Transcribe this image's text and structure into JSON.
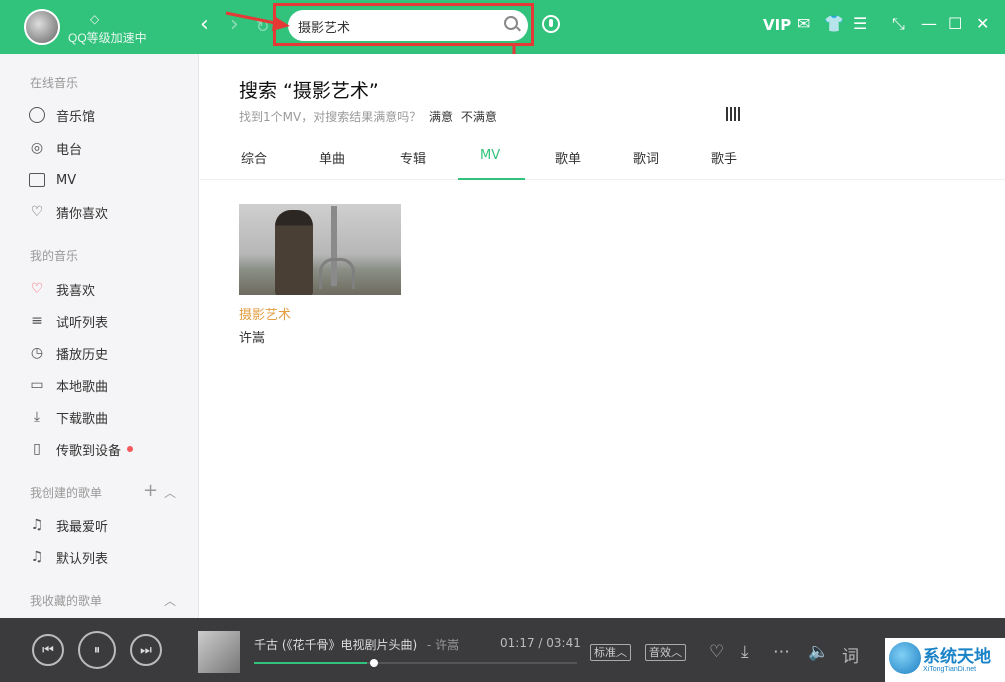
{
  "app": {
    "user": {
      "name": "QQ等级加速中"
    }
  },
  "search": {
    "value": "摄影艺术"
  },
  "topbar": {
    "vip_label": "VIP"
  },
  "sidebar": {
    "online_title": "在线音乐",
    "online": [
      {
        "label": "音乐馆",
        "icon": "music-hall-icon"
      },
      {
        "label": "电台",
        "icon": "radio-icon"
      },
      {
        "label": "MV",
        "icon": "mv-icon"
      },
      {
        "label": "猜你喜欢",
        "icon": "heart-guess-icon"
      }
    ],
    "my_title": "我的音乐",
    "my": [
      {
        "label": "我喜欢",
        "icon": "heart-icon"
      },
      {
        "label": "试听列表",
        "icon": "playlist-icon"
      },
      {
        "label": "播放历史",
        "icon": "history-icon"
      },
      {
        "label": "本地歌曲",
        "icon": "computer-icon"
      },
      {
        "label": "下载歌曲",
        "icon": "download-icon"
      },
      {
        "label": "传歌到设备",
        "icon": "device-icon"
      }
    ],
    "created_title": "我创建的歌单",
    "created": [
      {
        "label": "我最爱听",
        "icon": "note-icon"
      },
      {
        "label": "默认列表",
        "icon": "note-icon"
      }
    ],
    "collected_title": "我收藏的歌单"
  },
  "main": {
    "heading": "搜索 “摄影艺术”",
    "subtitle": "找到1个MV，对搜索结果满意吗？",
    "satisfied": "满意",
    "unsatisfied": "不满意",
    "tabs": [
      "综合",
      "单曲",
      "专辑",
      "MV",
      "歌单",
      "歌词",
      "歌手"
    ],
    "active_tab": "MV",
    "mv": {
      "title": "摄影艺术",
      "singer": "许嵩"
    }
  },
  "player": {
    "song": "千古 (《花千骨》电视剧片头曲)",
    "artist": "- 许嵩",
    "time": "01:17 / 03:41",
    "progress": 0.35,
    "quality": "标准",
    "effect": "音效",
    "lyric_label": "词"
  },
  "watermark": {
    "text": "系统天地",
    "sub": "XiTongTianDi.net"
  },
  "colors": {
    "brand": "#31c27c",
    "annotation": "#e53935",
    "mv_title": "#e29d42"
  }
}
